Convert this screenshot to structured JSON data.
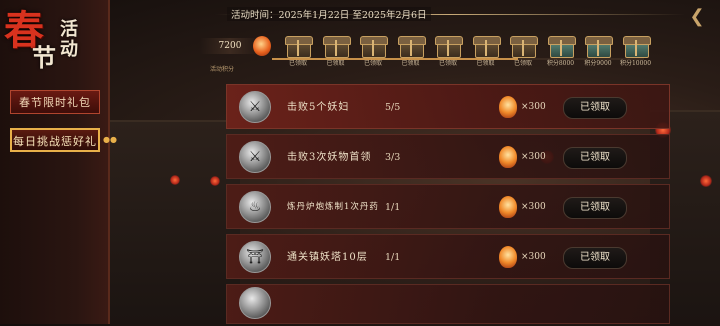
{
  "title": {
    "chun": "春",
    "jie": "节",
    "huodong": "活动"
  },
  "sidebar": {
    "tabs": [
      {
        "label": "春节限时礼包",
        "active": false
      },
      {
        "label": "每日挑战惩好礼",
        "active": true
      }
    ]
  },
  "header": {
    "activity_time": "活动时间：2025年1月22日 至2025年2月6日"
  },
  "points": {
    "value": "7200",
    "label": "活动积分"
  },
  "chests": [
    {
      "label": "已领取",
      "state": "claimed"
    },
    {
      "label": "已领取",
      "state": "claimed"
    },
    {
      "label": "已领取",
      "state": "claimed"
    },
    {
      "label": "已领取",
      "state": "claimed"
    },
    {
      "label": "已领取",
      "state": "claimed"
    },
    {
      "label": "已领取",
      "state": "claimed"
    },
    {
      "label": "已领取",
      "state": "claimed"
    },
    {
      "label": "积分8000",
      "state": "locked"
    },
    {
      "label": "积分9000",
      "state": "locked"
    },
    {
      "label": "积分10000",
      "state": "locked"
    }
  ],
  "progress_fraction": 0.66,
  "tasks": [
    {
      "name": "击败5个妖妇",
      "progress": "5/5",
      "reward": "×300",
      "button": "已领取",
      "icon": "sword-icon"
    },
    {
      "name": "击败3次妖物首领",
      "progress": "3/3",
      "reward": "×300",
      "button": "已领取",
      "icon": "sword-icon"
    },
    {
      "name": "炼丹炉炮炼制1次丹药",
      "progress": "1/1",
      "reward": "×300",
      "button": "已领取",
      "icon": "cauldron-icon"
    },
    {
      "name": "通关镇妖塔10层",
      "progress": "1/1",
      "reward": "×300",
      "button": "已领取",
      "icon": "pagoda-icon"
    }
  ]
}
